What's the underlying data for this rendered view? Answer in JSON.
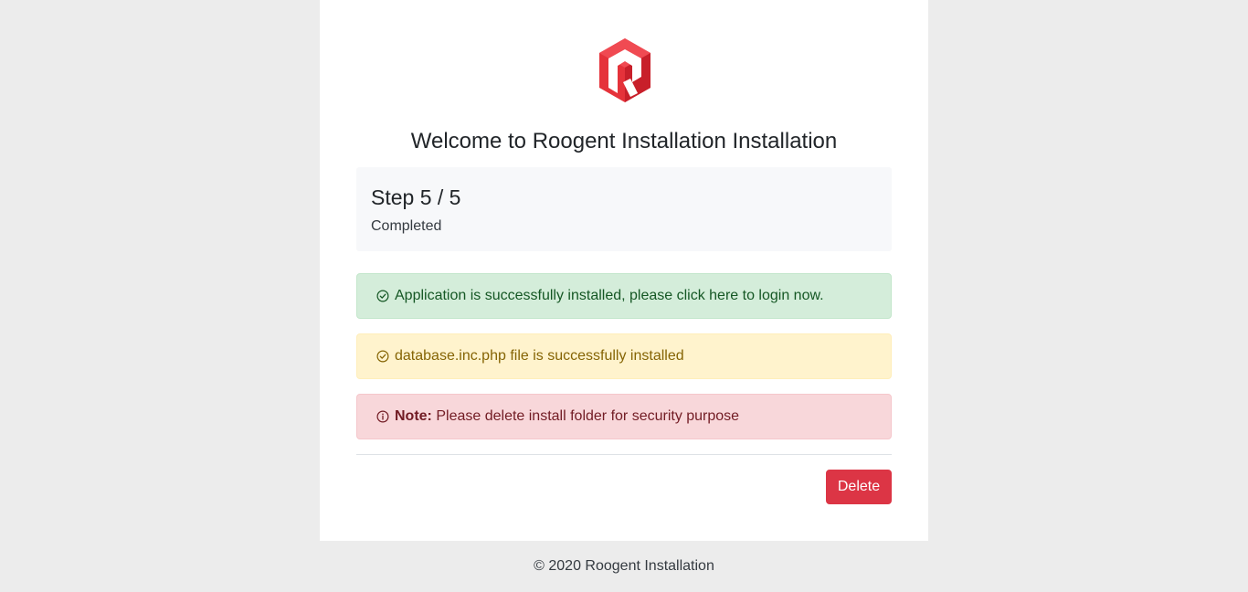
{
  "header": {
    "title": "Welcome to Roogent Installation Installation"
  },
  "step": {
    "title": "Step 5 / 5",
    "subtitle": "Completed"
  },
  "alerts": {
    "success": {
      "icon": "check-circle-icon",
      "text": "Application is successfully installed, please click here to login now."
    },
    "warning": {
      "icon": "check-circle-icon",
      "text": "database.inc.php file is successfully installed"
    },
    "danger": {
      "icon": "info-circle-icon",
      "label": "Note:",
      "text": "Please delete install folder for security purpose"
    }
  },
  "actions": {
    "delete_label": "Delete"
  },
  "footer": {
    "text": "© 2020 Roogent Installation"
  },
  "colors": {
    "brand": "#e5323a",
    "success_bg": "#d4edda",
    "warning_bg": "#fff3cd",
    "danger_bg": "#f8d7da",
    "button_danger": "#dc3545"
  }
}
